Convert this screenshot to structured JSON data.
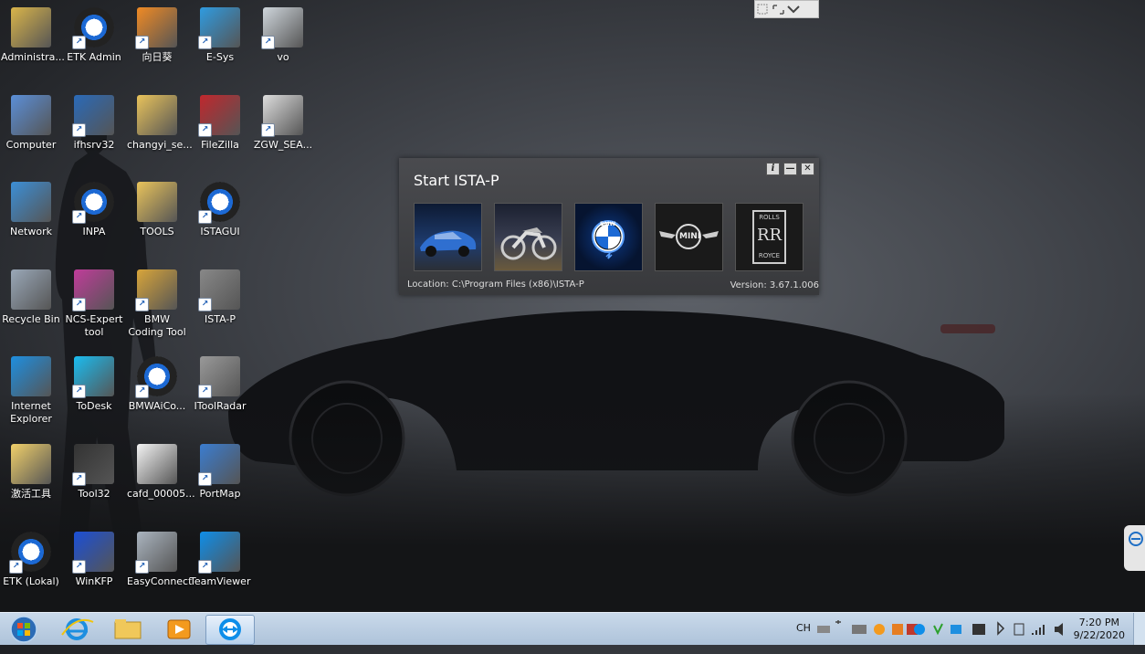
{
  "desktop_icons": [
    {
      "label": "Administra...",
      "icon": "user-folder-icon"
    },
    {
      "label": "ETK Admin",
      "icon": "bmw-etk-icon"
    },
    {
      "label": "向日葵",
      "icon": "sunflower-icon"
    },
    {
      "label": "E-Sys",
      "icon": "esys-icon"
    },
    {
      "label": "vo",
      "icon": "vo-icon"
    },
    {
      "label": "Computer",
      "icon": "computer-icon"
    },
    {
      "label": "ifhsrv32",
      "icon": "network-server-icon"
    },
    {
      "label": "changyi_se...",
      "icon": "folder-icon"
    },
    {
      "label": "FileZilla",
      "icon": "filezilla-icon"
    },
    {
      "label": "ZGW_SEA...",
      "icon": "binoculars-icon"
    },
    {
      "label": "Network",
      "icon": "network-globe-icon"
    },
    {
      "label": "INPA",
      "icon": "bmw-inpa-icon"
    },
    {
      "label": "TOOLS",
      "icon": "folder-icon"
    },
    {
      "label": "ISTAGUI",
      "icon": "bmw-logo-icon"
    },
    {
      "label": "Recycle Bin",
      "icon": "recycle-bin-icon"
    },
    {
      "label": "NCS-Expert tool",
      "icon": "ncs-expert-icon"
    },
    {
      "label": "BMW Coding Tool",
      "icon": "coding-tool-icon"
    },
    {
      "label": "ISTA-P",
      "icon": "ista-p-icon"
    },
    {
      "label": "Internet Explorer",
      "icon": "internet-explorer-icon"
    },
    {
      "label": "ToDesk",
      "icon": "todesk-icon"
    },
    {
      "label": "BMWAiCo...",
      "icon": "bmwaico-icon"
    },
    {
      "label": "IToolRadar",
      "icon": "itoolradar-icon"
    },
    {
      "label": "激活工具",
      "icon": "activation-tool-icon"
    },
    {
      "label": "Tool32",
      "icon": "tool32-eye-icon"
    },
    {
      "label": "cafd_00005...",
      "icon": "file-icon"
    },
    {
      "label": "PortMap",
      "icon": "portmap-icon"
    },
    {
      "label": "ETK (Lokal)",
      "icon": "bmw-etk-icon"
    },
    {
      "label": "WinKFP",
      "icon": "winkfp-icon"
    },
    {
      "label": "EasyConnect",
      "icon": "easyconnect-icon"
    },
    {
      "label": "TeamViewer",
      "icon": "teamviewer-icon"
    }
  ],
  "dialog": {
    "title": "Start ISTA-P",
    "brands": [
      "bmw-car",
      "bmw-motorrad",
      "bmw-i",
      "mini",
      "rolls-royce"
    ],
    "mini_label": "MINI",
    "rr_label_top": "ROLLS",
    "rr_label_mid": "RR",
    "rr_label_bottom": "ROYCE",
    "bmw_label": "BMW",
    "location": "Location:  C:\\Program Files (x86)\\ISTA-P",
    "version": "Version:  3.67.1.006",
    "info_btn": "i",
    "minimize_btn": "—",
    "close_btn": "✕"
  },
  "taskbar": {
    "pinned": [
      "start-orb",
      "internet-explorer",
      "explorer",
      "media-player",
      "teamviewer"
    ],
    "lang": "CH",
    "time": "7:20 PM",
    "date": "9/22/2020"
  },
  "colors": {
    "taskbar": "#bcd0e4",
    "dialog": "#3f4043",
    "bmw_blue": "#1c69d4"
  }
}
